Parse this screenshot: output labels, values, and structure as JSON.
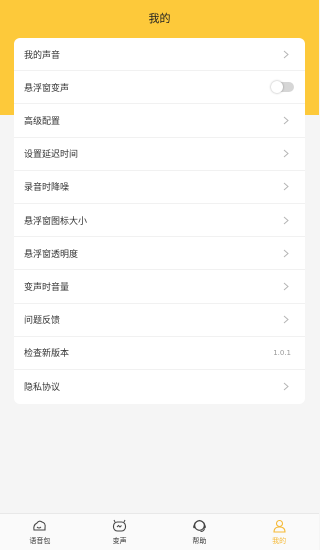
{
  "header": {
    "title": "我的"
  },
  "settings": [
    {
      "label": "我的声音",
      "control": "chevron"
    },
    {
      "label": "悬浮窗变声",
      "control": "toggle",
      "enabled": false
    },
    {
      "label": "高级配置",
      "control": "chevron"
    },
    {
      "label": "设置延迟时间",
      "control": "chevron"
    },
    {
      "label": "录音时降噪",
      "control": "chevron"
    },
    {
      "label": "悬浮窗图标大小",
      "control": "chevron"
    },
    {
      "label": "悬浮窗透明度",
      "control": "chevron"
    },
    {
      "label": "变声时音量",
      "control": "chevron"
    },
    {
      "label": "问题反馈",
      "control": "chevron"
    },
    {
      "label": "检查新版本",
      "control": "value",
      "value": "1.0.1"
    },
    {
      "label": "隐私协议",
      "control": "chevron"
    }
  ],
  "tabbar": {
    "items": [
      {
        "label": "语音包",
        "icon": "voice-pack-icon"
      },
      {
        "label": "变声",
        "icon": "voice-change-icon"
      },
      {
        "label": "帮助",
        "icon": "help-icon"
      },
      {
        "label": "我的",
        "icon": "profile-icon",
        "active": true
      }
    ]
  },
  "colors": {
    "accent": "#fdc93a",
    "active_tab": "#f5b936"
  }
}
